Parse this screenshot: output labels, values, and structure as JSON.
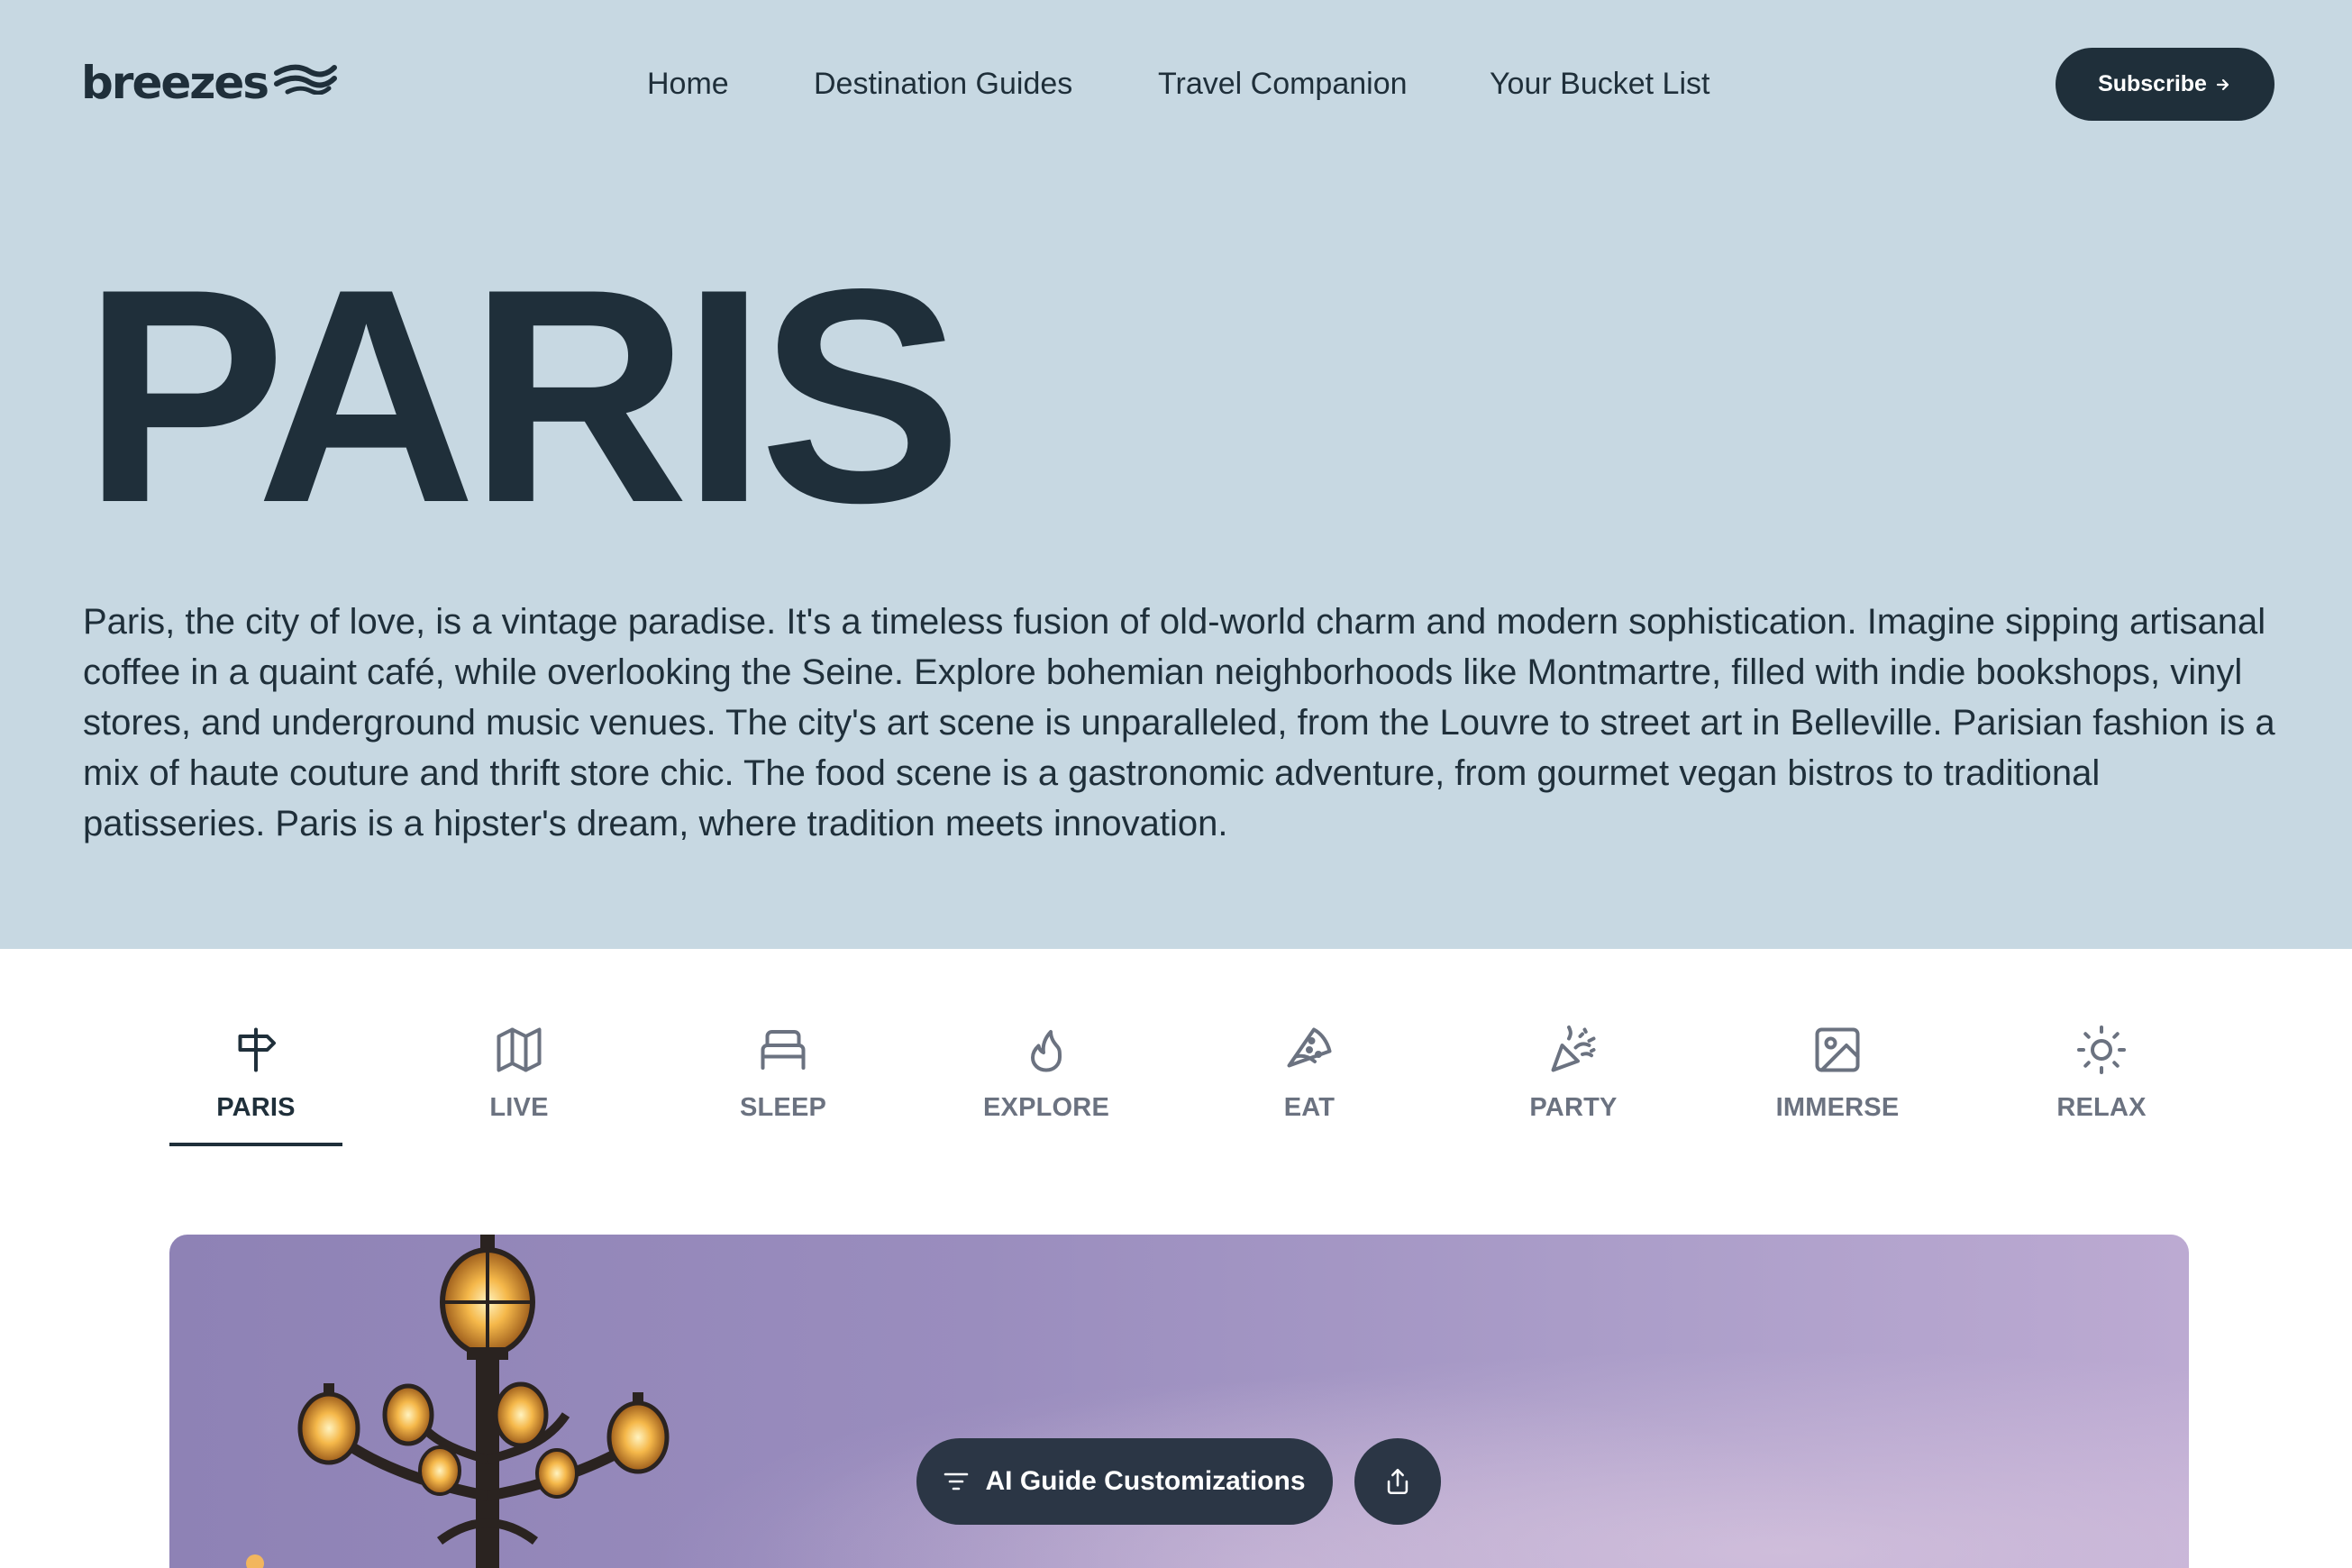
{
  "brand": {
    "name": "breezes",
    "color": "#1f2f3a"
  },
  "nav": {
    "items": [
      {
        "label": "Home"
      },
      {
        "label": "Destination Guides"
      },
      {
        "label": "Travel Companion"
      },
      {
        "label": "Your Bucket List"
      }
    ],
    "subscribe_label": "Subscribe",
    "subscribe_icon": "arrow-right-icon"
  },
  "hero": {
    "title": "PARIS",
    "description": "Paris, the city of love, is a vintage paradise. It's a timeless fusion of old-world charm and modern sophistication. Imagine sipping artisanal coffee in a quaint café, while overlooking the Seine. Explore bohemian neighborhoods like Montmartre, filled with indie bookshops, vinyl stores, and underground music venues. The city's art scene is unparalleled, from the Louvre to street art in Belleville. Parisian fashion is a mix of haute couture and thrift store chic. The food scene is a gastronomic adventure, from gourmet vegan bistros to traditional patisseries. Paris is a hipster's dream, where tradition meets innovation.",
    "background": "#c7d8e2"
  },
  "tabs": [
    {
      "label": "PARIS",
      "icon": "signpost-icon",
      "active": true
    },
    {
      "label": "LIVE",
      "icon": "map-icon",
      "active": false
    },
    {
      "label": "SLEEP",
      "icon": "bed-icon",
      "active": false
    },
    {
      "label": "EXPLORE",
      "icon": "flame-icon",
      "active": false
    },
    {
      "label": "EAT",
      "icon": "pizza-icon",
      "active": false
    },
    {
      "label": "PARTY",
      "icon": "party-popper-icon",
      "active": false
    },
    {
      "label": "IMMERSE",
      "icon": "image-icon",
      "active": false
    },
    {
      "label": "RELAX",
      "icon": "sun-icon",
      "active": false
    }
  ],
  "actions": {
    "ai_guide_label": "AI Guide Customizations",
    "ai_guide_icon": "filter-icon",
    "share_icon": "share-icon"
  }
}
